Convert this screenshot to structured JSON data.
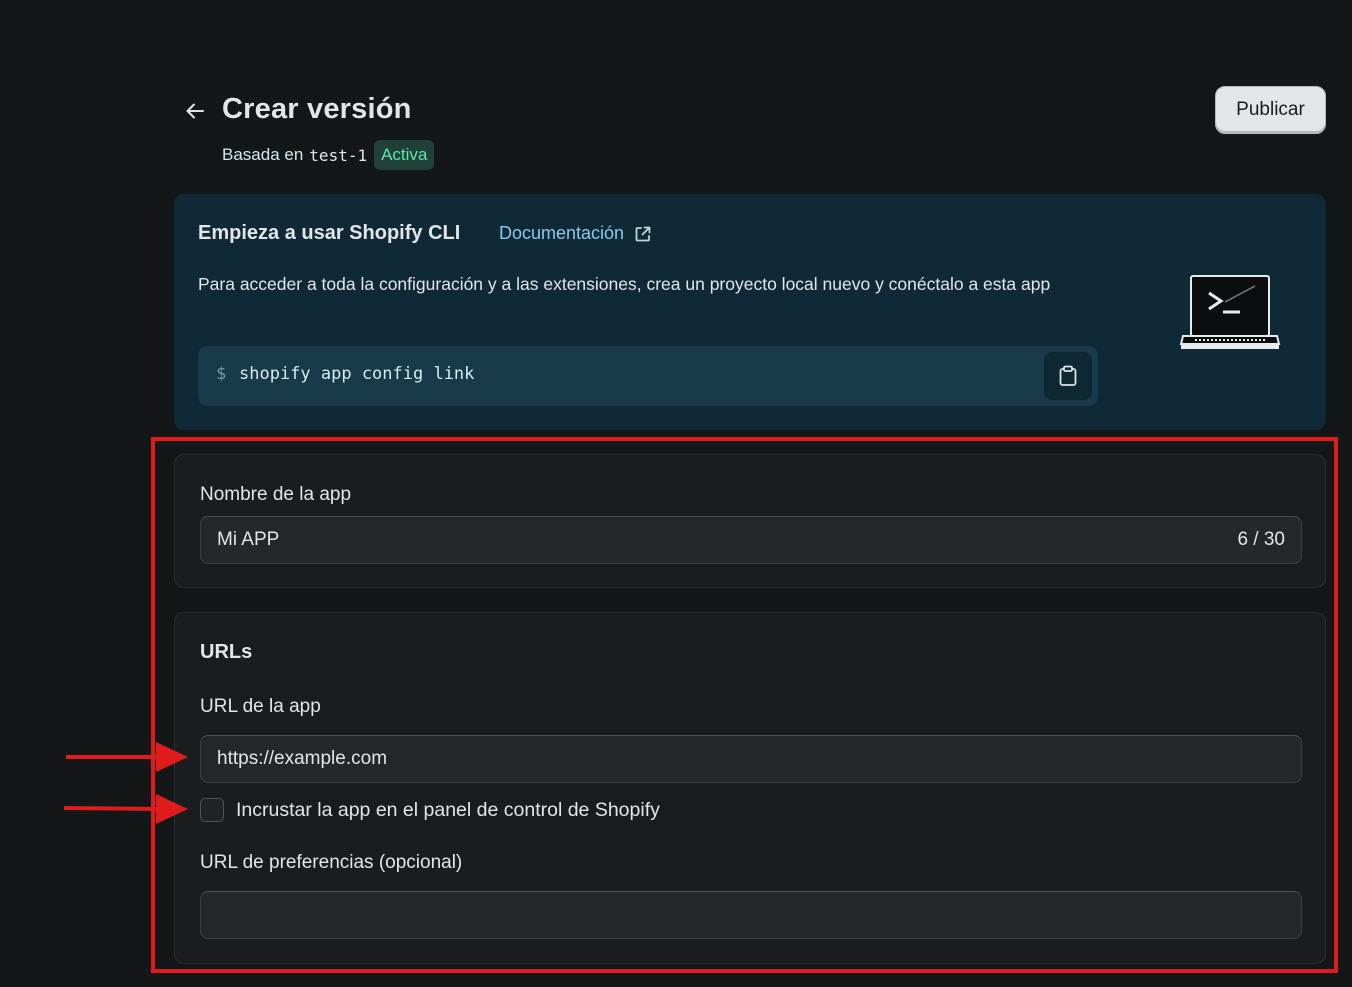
{
  "header": {
    "title": "Crear versión",
    "based_on_prefix": "Basada en",
    "version": "test-1",
    "status_badge": "Activa",
    "publish_label": "Publicar"
  },
  "banner": {
    "heading": "Empieza a usar Shopify CLI",
    "doc_link": "Documentación",
    "description": "Para acceder a toda la configuración y a las extensiones, crea un proyecto local nuevo y conéctalo a esta app",
    "prompt": "$",
    "command": "shopify app config link"
  },
  "app_name": {
    "label": "Nombre de la app",
    "value": "Mi APP",
    "counter": "6 / 30"
  },
  "urls": {
    "title": "URLs",
    "app_url_label": "URL de la app",
    "app_url_value": "https://example.com",
    "embed_label": "Incrustar la app en el panel de control de Shopify",
    "embed_checked": false,
    "preferences_label": "URL de preferencias (opcional)",
    "preferences_value": ""
  },
  "colors": {
    "background": "#131718",
    "banner": "#0f2a36",
    "badge_text": "#5ee6a6",
    "link": "#8cc8ef",
    "annotation": "#e01b1b"
  }
}
